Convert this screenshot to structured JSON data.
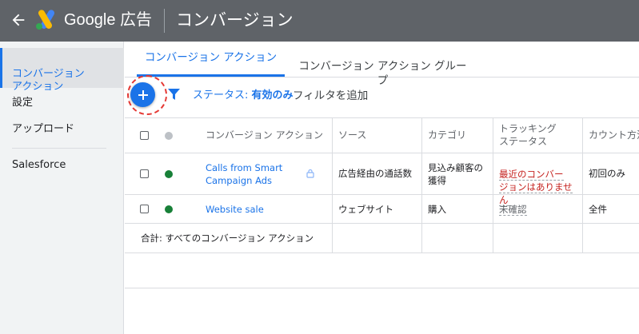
{
  "header": {
    "brand": "Google 広告",
    "page_title": "コンバージョン"
  },
  "sidebar": {
    "items": [
      {
        "label": "コンバージョン\nアクション"
      },
      {
        "label": "設定"
      },
      {
        "label": "アップロード"
      },
      {
        "label": "Salesforce"
      }
    ]
  },
  "tabs": [
    {
      "label": "コンバージョン アクション"
    },
    {
      "label": "コンバージョン アクション グルー\nプ"
    }
  ],
  "filters": {
    "add_icon": "plus-icon",
    "status_prefix": "ステータス:",
    "status_value": "有効のみ",
    "add_filter": "フィルタを追加"
  },
  "table": {
    "headers": {
      "action": "コンバージョン アクション",
      "source": "ソース",
      "category": "カテゴリ",
      "tracking": "トラッキング\nステータス",
      "count": "カウント方法"
    },
    "rows": [
      {
        "status_color": "#188038",
        "action": "Calls from Smart\nCampaign Ads",
        "locked": true,
        "source": "広告経由の通話数",
        "category": "見込み顧客の\n獲得",
        "tracking": "最近のコンバー\nジョンはありませ\nん",
        "count": "初回のみ"
      },
      {
        "status_color": "#188038",
        "action": "Website sale",
        "locked": false,
        "source": "ウェブサイト",
        "category": "購入",
        "tracking": "未確認",
        "count": "全件"
      }
    ],
    "total_label": "合計: すべてのコンバージョン アクション"
  },
  "colors": {
    "accent": "#1a73e8",
    "topbar": "#5f6368",
    "warning": "#c5221f",
    "status_green": "#188038",
    "highlight_ring": "#e53935"
  }
}
